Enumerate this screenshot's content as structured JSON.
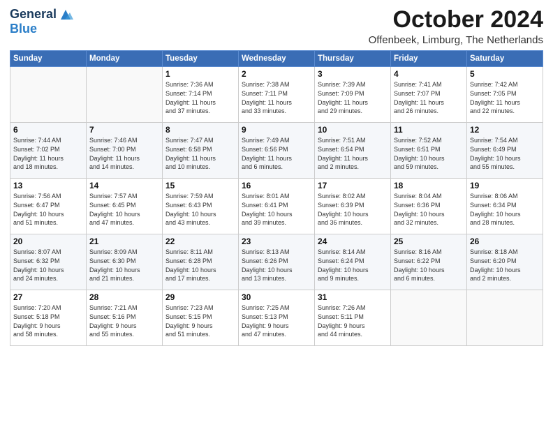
{
  "logo": {
    "line1": "General",
    "line2": "Blue"
  },
  "title": "October 2024",
  "location": "Offenbeek, Limburg, The Netherlands",
  "days_header": [
    "Sunday",
    "Monday",
    "Tuesday",
    "Wednesday",
    "Thursday",
    "Friday",
    "Saturday"
  ],
  "weeks": [
    [
      {
        "day": "",
        "detail": ""
      },
      {
        "day": "",
        "detail": ""
      },
      {
        "day": "1",
        "detail": "Sunrise: 7:36 AM\nSunset: 7:14 PM\nDaylight: 11 hours\nand 37 minutes."
      },
      {
        "day": "2",
        "detail": "Sunrise: 7:38 AM\nSunset: 7:11 PM\nDaylight: 11 hours\nand 33 minutes."
      },
      {
        "day": "3",
        "detail": "Sunrise: 7:39 AM\nSunset: 7:09 PM\nDaylight: 11 hours\nand 29 minutes."
      },
      {
        "day": "4",
        "detail": "Sunrise: 7:41 AM\nSunset: 7:07 PM\nDaylight: 11 hours\nand 26 minutes."
      },
      {
        "day": "5",
        "detail": "Sunrise: 7:42 AM\nSunset: 7:05 PM\nDaylight: 11 hours\nand 22 minutes."
      }
    ],
    [
      {
        "day": "6",
        "detail": "Sunrise: 7:44 AM\nSunset: 7:02 PM\nDaylight: 11 hours\nand 18 minutes."
      },
      {
        "day": "7",
        "detail": "Sunrise: 7:46 AM\nSunset: 7:00 PM\nDaylight: 11 hours\nand 14 minutes."
      },
      {
        "day": "8",
        "detail": "Sunrise: 7:47 AM\nSunset: 6:58 PM\nDaylight: 11 hours\nand 10 minutes."
      },
      {
        "day": "9",
        "detail": "Sunrise: 7:49 AM\nSunset: 6:56 PM\nDaylight: 11 hours\nand 6 minutes."
      },
      {
        "day": "10",
        "detail": "Sunrise: 7:51 AM\nSunset: 6:54 PM\nDaylight: 11 hours\nand 2 minutes."
      },
      {
        "day": "11",
        "detail": "Sunrise: 7:52 AM\nSunset: 6:51 PM\nDaylight: 10 hours\nand 59 minutes."
      },
      {
        "day": "12",
        "detail": "Sunrise: 7:54 AM\nSunset: 6:49 PM\nDaylight: 10 hours\nand 55 minutes."
      }
    ],
    [
      {
        "day": "13",
        "detail": "Sunrise: 7:56 AM\nSunset: 6:47 PM\nDaylight: 10 hours\nand 51 minutes."
      },
      {
        "day": "14",
        "detail": "Sunrise: 7:57 AM\nSunset: 6:45 PM\nDaylight: 10 hours\nand 47 minutes."
      },
      {
        "day": "15",
        "detail": "Sunrise: 7:59 AM\nSunset: 6:43 PM\nDaylight: 10 hours\nand 43 minutes."
      },
      {
        "day": "16",
        "detail": "Sunrise: 8:01 AM\nSunset: 6:41 PM\nDaylight: 10 hours\nand 39 minutes."
      },
      {
        "day": "17",
        "detail": "Sunrise: 8:02 AM\nSunset: 6:39 PM\nDaylight: 10 hours\nand 36 minutes."
      },
      {
        "day": "18",
        "detail": "Sunrise: 8:04 AM\nSunset: 6:36 PM\nDaylight: 10 hours\nand 32 minutes."
      },
      {
        "day": "19",
        "detail": "Sunrise: 8:06 AM\nSunset: 6:34 PM\nDaylight: 10 hours\nand 28 minutes."
      }
    ],
    [
      {
        "day": "20",
        "detail": "Sunrise: 8:07 AM\nSunset: 6:32 PM\nDaylight: 10 hours\nand 24 minutes."
      },
      {
        "day": "21",
        "detail": "Sunrise: 8:09 AM\nSunset: 6:30 PM\nDaylight: 10 hours\nand 21 minutes."
      },
      {
        "day": "22",
        "detail": "Sunrise: 8:11 AM\nSunset: 6:28 PM\nDaylight: 10 hours\nand 17 minutes."
      },
      {
        "day": "23",
        "detail": "Sunrise: 8:13 AM\nSunset: 6:26 PM\nDaylight: 10 hours\nand 13 minutes."
      },
      {
        "day": "24",
        "detail": "Sunrise: 8:14 AM\nSunset: 6:24 PM\nDaylight: 10 hours\nand 9 minutes."
      },
      {
        "day": "25",
        "detail": "Sunrise: 8:16 AM\nSunset: 6:22 PM\nDaylight: 10 hours\nand 6 minutes."
      },
      {
        "day": "26",
        "detail": "Sunrise: 8:18 AM\nSunset: 6:20 PM\nDaylight: 10 hours\nand 2 minutes."
      }
    ],
    [
      {
        "day": "27",
        "detail": "Sunrise: 7:20 AM\nSunset: 5:18 PM\nDaylight: 9 hours\nand 58 minutes."
      },
      {
        "day": "28",
        "detail": "Sunrise: 7:21 AM\nSunset: 5:16 PM\nDaylight: 9 hours\nand 55 minutes."
      },
      {
        "day": "29",
        "detail": "Sunrise: 7:23 AM\nSunset: 5:15 PM\nDaylight: 9 hours\nand 51 minutes."
      },
      {
        "day": "30",
        "detail": "Sunrise: 7:25 AM\nSunset: 5:13 PM\nDaylight: 9 hours\nand 47 minutes."
      },
      {
        "day": "31",
        "detail": "Sunrise: 7:26 AM\nSunset: 5:11 PM\nDaylight: 9 hours\nand 44 minutes."
      },
      {
        "day": "",
        "detail": ""
      },
      {
        "day": "",
        "detail": ""
      }
    ]
  ]
}
